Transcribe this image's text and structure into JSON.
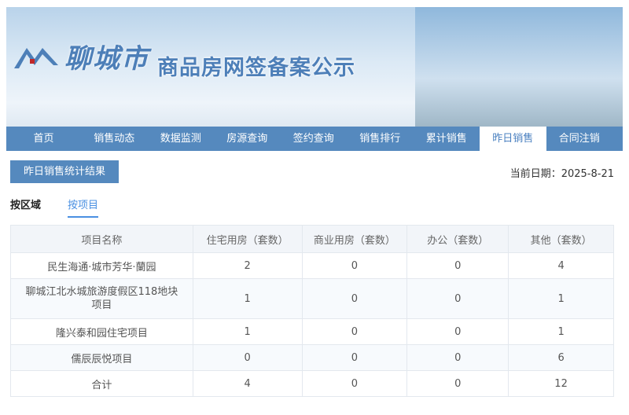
{
  "header": {
    "city": "聊城市",
    "subtitle": "商品房网签备案公示",
    "logo_text": "liaocheng"
  },
  "nav": [
    "首页",
    "销售动态",
    "数据监测",
    "房源查询",
    "签约查询",
    "销售排行",
    "累计销售",
    "昨日销售",
    "合同注销"
  ],
  "active_nav": "昨日销售",
  "button": "昨日销售统计结果",
  "date": "当前日期：2025-8-21",
  "tabs": [
    "按区域",
    "按项目"
  ],
  "active_tab": "按项目",
  "table": {
    "headers": [
      "项目名称",
      "住宅用房（套数）",
      "商业用房（套数）",
      "办公（套数）",
      "其他（套数）"
    ],
    "rows": [
      [
        "民生海通·城市芳华·蘭园",
        "2",
        "0",
        "0",
        "4"
      ],
      [
        "聊城江北水城旅游度假区118地块项目",
        "1",
        "0",
        "0",
        "1"
      ],
      [
        "隆兴泰和园住宅项目",
        "1",
        "0",
        "0",
        "1"
      ],
      [
        "儒辰辰悦项目",
        "0",
        "0",
        "0",
        "6"
      ],
      [
        "合计",
        "4",
        "0",
        "0",
        "12"
      ]
    ]
  }
}
